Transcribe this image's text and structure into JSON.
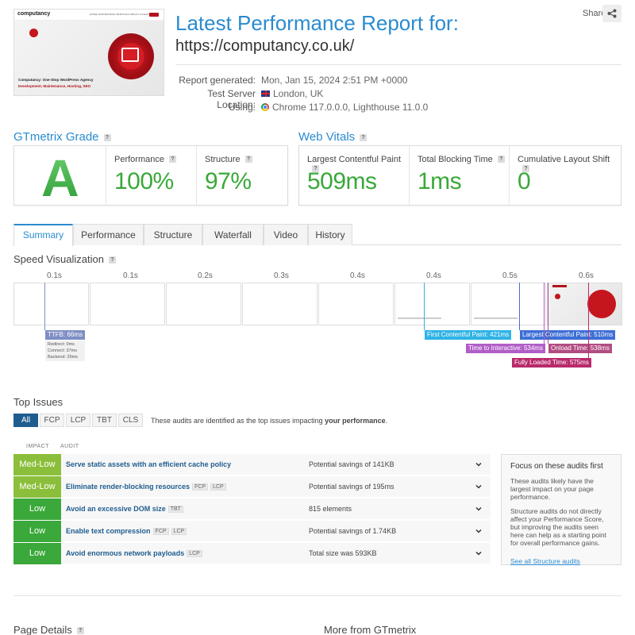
{
  "thumbnail": {
    "logo": "computancy",
    "nav": "HOME   WORDPRESS SERVICES   ABOUT   CLIENTS",
    "line1": "Computancy: One-Stop WordPress Agency",
    "line2": "Development, Maintenance, Hosting, SEO"
  },
  "header": {
    "title": "Latest Performance Report for:",
    "url": "https://computancy.co.uk/",
    "share": "Share"
  },
  "meta": [
    {
      "key": "Report generated:",
      "value": "Mon, Jan 15, 2024 2:51 PM +0000"
    },
    {
      "key": "Test Server Location:",
      "value": "London, UK"
    },
    {
      "key": "Using:",
      "value": "Chrome 117.0.0.0, Lighthouse 11.0.0"
    }
  ],
  "grade": {
    "title": "GTmetrix Grade",
    "letter": "A",
    "performance_label": "Performance",
    "performance": "100%",
    "structure_label": "Structure",
    "structure": "97%"
  },
  "vitals": {
    "title": "Web Vitals",
    "lcp_label": "Largest Contentful Paint",
    "lcp": "509ms",
    "tbt_label": "Total Blocking Time",
    "tbt": "1ms",
    "cls_label": "Cumulative Layout Shift",
    "cls": "0"
  },
  "tabs": [
    "Summary",
    "Performance",
    "Structure",
    "Waterfall",
    "Video",
    "History"
  ],
  "speed": {
    "title": "Speed Visualization",
    "ticks": [
      "0.1s",
      "0.1s",
      "0.2s",
      "0.3s",
      "0.4s",
      "0.4s",
      "0.5s",
      "0.6s"
    ],
    "ttfb": "TTFB: 66ms",
    "redirect": "Redirect: 0ms",
    "connect": "Connect: 37ms",
    "backend": "Backend: 29ms",
    "fcp": "First Contentful Paint: 421ms",
    "lcp": "Largest Contentful Paint: 510ms",
    "tti": "Time to Interactive: 534ms",
    "onload": "Onload Time: 538ms",
    "fully": "Fully Loaded Time: 575ms"
  },
  "issues": {
    "title": "Top Issues",
    "filters": [
      "All",
      "FCP",
      "LCP",
      "TBT",
      "CLS"
    ],
    "note_pre": "These audits are identified as the top issues impacting ",
    "note_bold": "your performance",
    "note_post": ".",
    "col_impact": "IMPACT",
    "col_audit": "AUDIT",
    "rows": [
      {
        "impact": "Med-Low",
        "audit": "Serve static assets with an efficient cache policy",
        "tags": [],
        "detail": "Potential savings of 141KB"
      },
      {
        "impact": "Med-Low",
        "audit": "Eliminate render-blocking resources",
        "tags": [
          "FCP",
          "LCP"
        ],
        "detail": "Potential savings of 195ms"
      },
      {
        "impact": "Low",
        "audit": "Avoid an excessive DOM size",
        "tags": [
          "TBT"
        ],
        "detail": "815 elements"
      },
      {
        "impact": "Low",
        "audit": "Enable text compression",
        "tags": [
          "FCP",
          "LCP"
        ],
        "detail": "Potential savings of 1.74KB"
      },
      {
        "impact": "Low",
        "audit": "Avoid enormous network payloads",
        "tags": [
          "LCP"
        ],
        "detail": "Total size was 593KB"
      }
    ],
    "side_title": "Focus on these audits first",
    "side_p1": "These audits likely have the largest impact on your page performance.",
    "side_p2": "Structure audits do not directly affect your Performance Score, but improving the audits seen here can help as a starting point for overall performance gains.",
    "side_link": "See all Structure audits"
  },
  "footer": {
    "page_details": "Page Details",
    "more": "More from GTmetrix"
  },
  "colors": {
    "accent": "#2a8bd0",
    "good": "#3aa83a",
    "medlow": "#8bbf3b",
    "low": "#3aa83a",
    "ttfb": "#7f8fc4",
    "fcp": "#2fb3e6",
    "lcp": "#3d6fd6",
    "tti": "#b15ec7",
    "onload": "#b14d83",
    "fully": "#b82a6b"
  }
}
